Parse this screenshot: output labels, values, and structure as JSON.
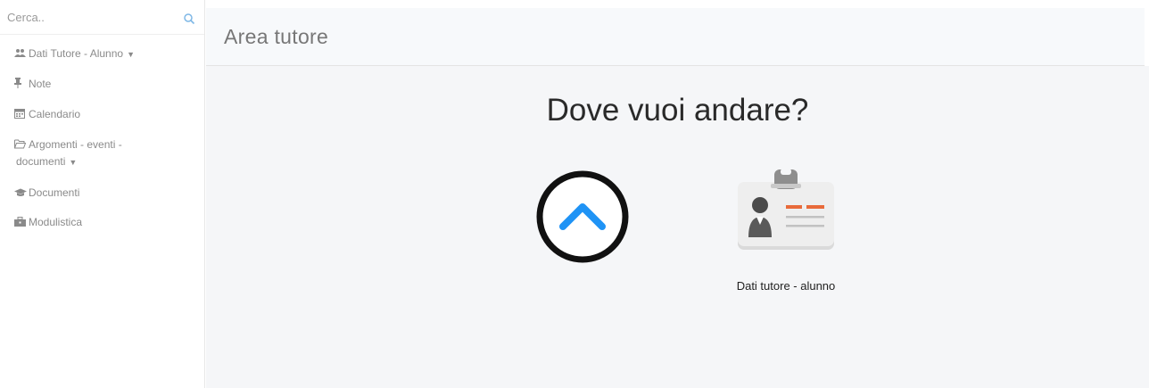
{
  "search": {
    "placeholder": "Cerca.."
  },
  "sidebar": {
    "items": [
      {
        "label": "Dati Tutore - Alunno",
        "icon": "users-icon",
        "has_caret": true
      },
      {
        "label": "Note",
        "icon": "thumbtack-icon",
        "has_caret": false
      },
      {
        "label": "Calendario",
        "icon": "calendar-icon",
        "has_caret": false
      },
      {
        "label": "Argomenti - eventi - documenti",
        "line1": "Argomenti - eventi -",
        "line2": "documenti",
        "icon": "folder-open-icon",
        "has_caret": true
      },
      {
        "label": "Documenti",
        "icon": "graduation-cap-icon",
        "has_caret": false
      },
      {
        "label": "Modulistica",
        "icon": "briefcase-icon",
        "has_caret": false
      }
    ]
  },
  "header": {
    "title": "Area tutore"
  },
  "main": {
    "question": "Dove vuoi andare?",
    "tiles": [
      {
        "label": "Dati tutore - alunno",
        "icon": "id-badge-icon"
      }
    ],
    "up_button_icon": "chevron-up-icon"
  },
  "colors": {
    "accent_blue": "#1f93f5",
    "ring": "#111111",
    "badge_orange": "#e86a3a",
    "header_bg": "#f7f9fb",
    "content_bg": "#f5f6f8"
  }
}
